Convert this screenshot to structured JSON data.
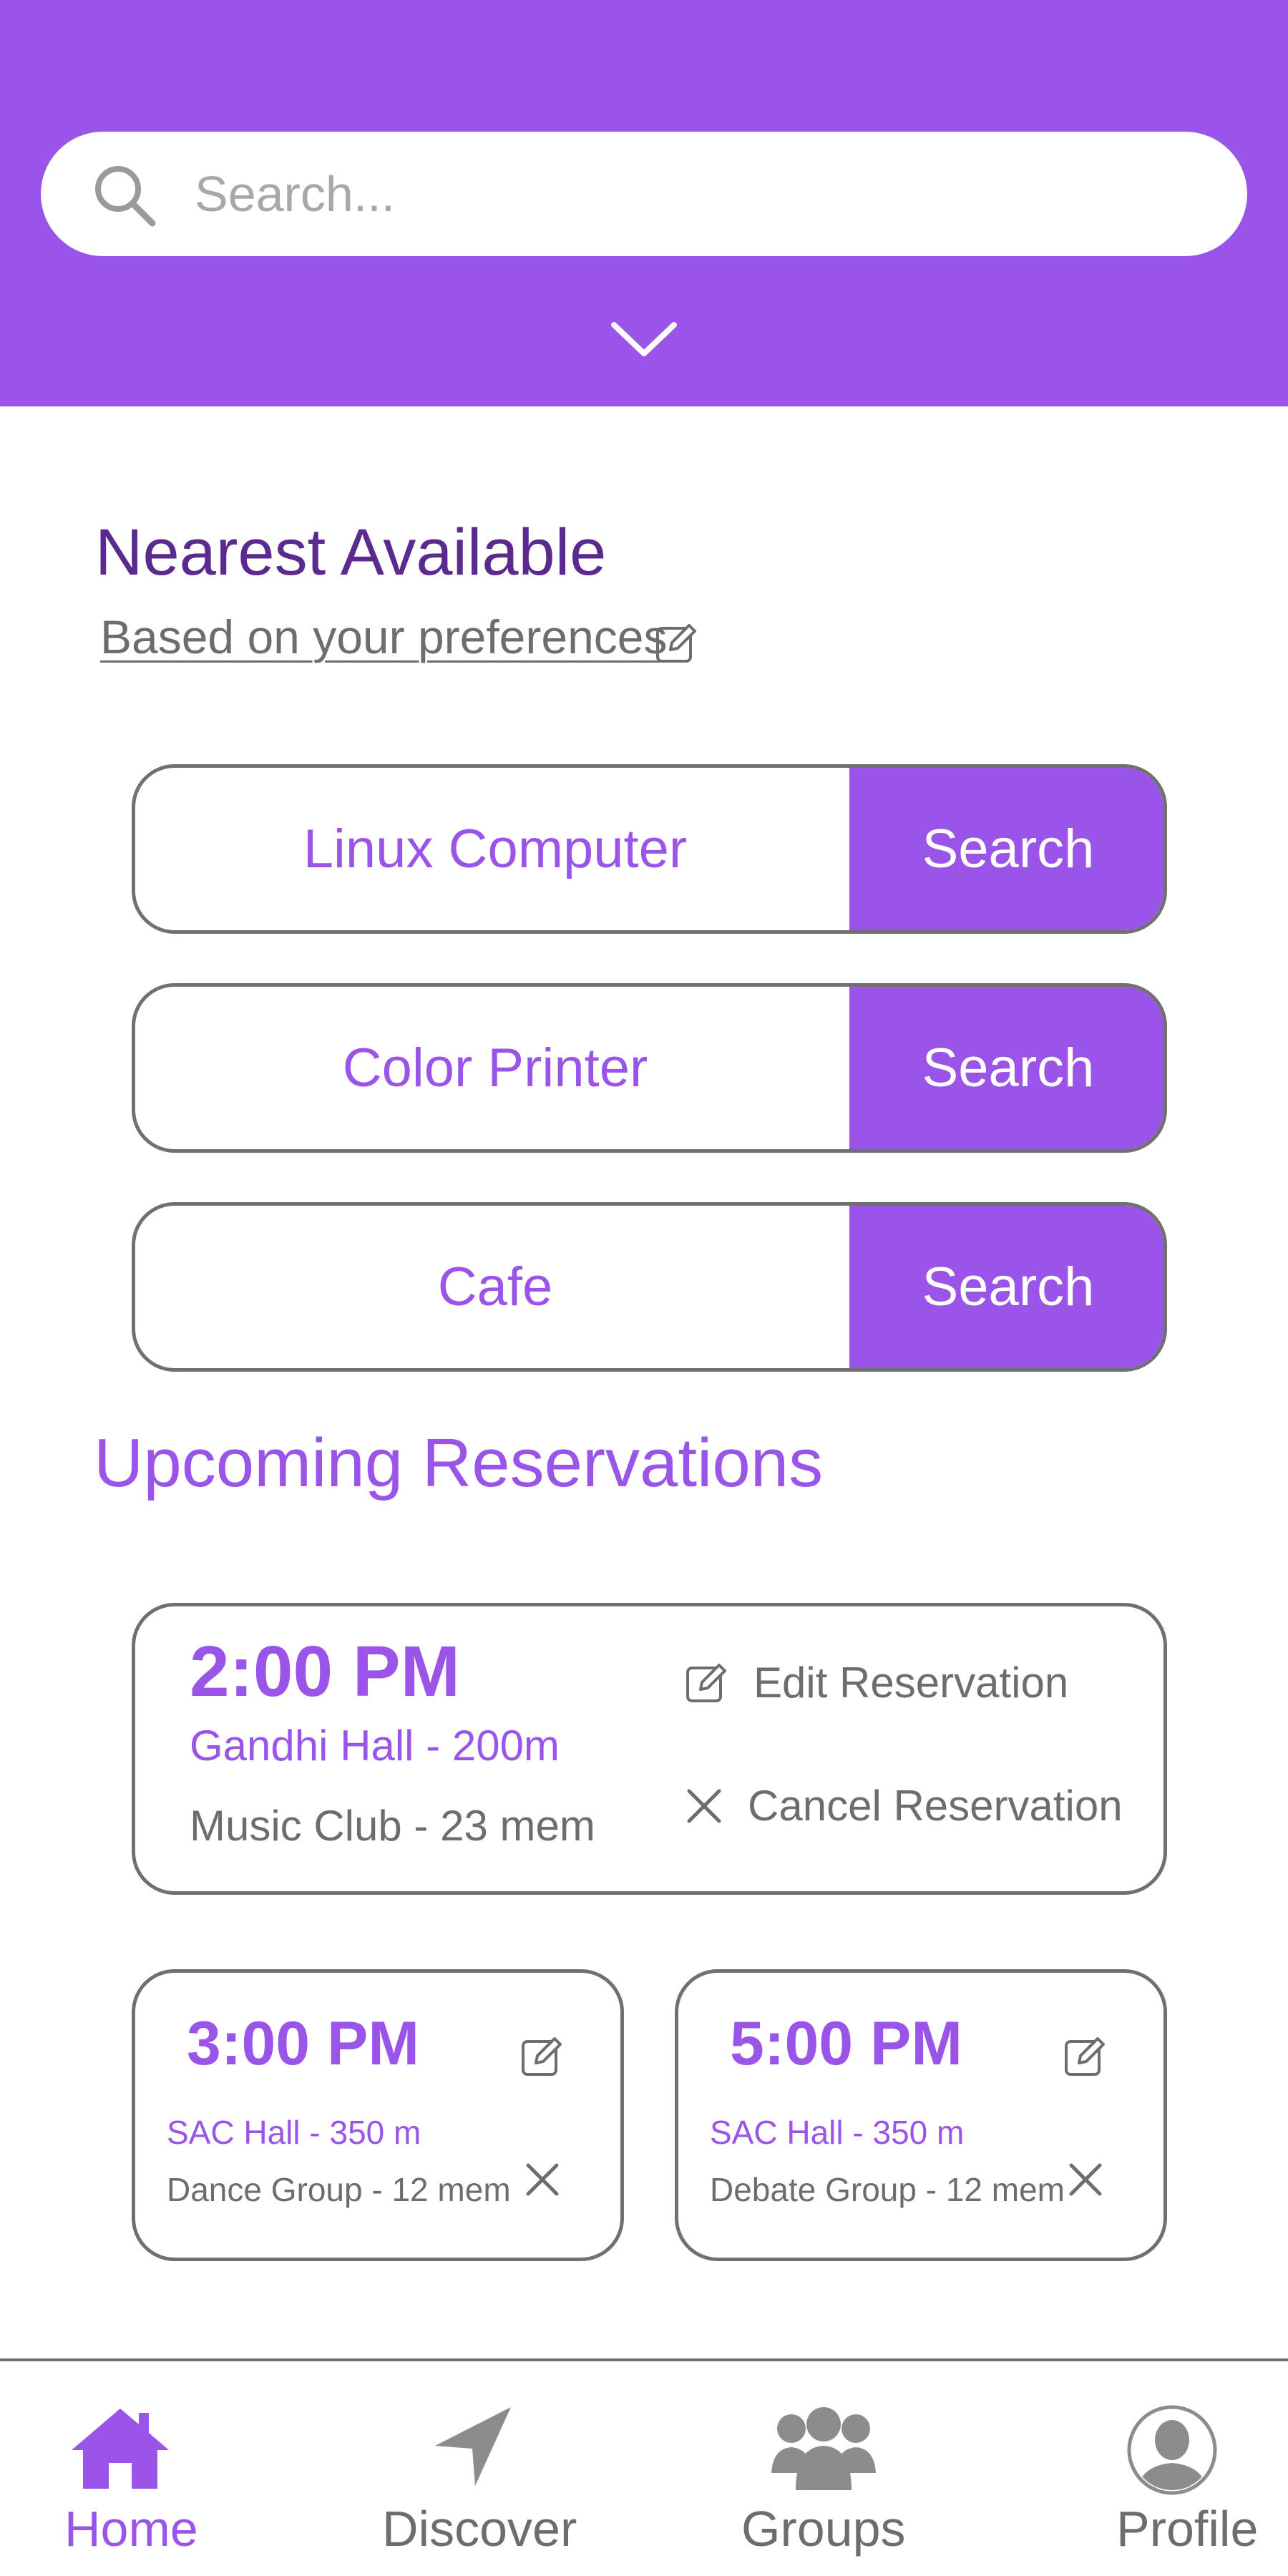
{
  "theme": {
    "accent": "#9a55e8",
    "accent_dark": "#5b2a8e",
    "border": "#707070",
    "muted_text": "#6d6d6d"
  },
  "search": {
    "placeholder": "Search...",
    "icon": "search-icon",
    "expand_icon": "chevron-down-icon"
  },
  "nearest": {
    "title": "Nearest Available",
    "subtitle": "Based on your preferences",
    "edit_icon": "pencil-icon",
    "items": [
      {
        "label": "Linux Computer",
        "button": "Search"
      },
      {
        "label": "Color Printer",
        "button": "Search"
      },
      {
        "label": "Cafe",
        "button": "Search"
      }
    ]
  },
  "upcoming": {
    "title": "Upcoming Reservations",
    "main": {
      "time": "2:00 PM",
      "location": "Gandhi Hall - 200m",
      "group": "Music Club - 23 mem",
      "edit_label": "Edit Reservation",
      "cancel_label": "Cancel Reservation"
    },
    "small": [
      {
        "time": "3:00 PM",
        "location": "SAC Hall - 350 m",
        "group": "Dance Group - 12 mem"
      },
      {
        "time": "5:00 PM",
        "location": "SAC Hall - 350 m",
        "group": "Debate Group - 12 mem"
      }
    ]
  },
  "nav": [
    {
      "label": "Home",
      "icon": "home-icon",
      "active": true
    },
    {
      "label": "Discover",
      "icon": "navigation-arrow-icon",
      "active": false
    },
    {
      "label": "Groups",
      "icon": "groups-icon",
      "active": false
    },
    {
      "label": "Profile",
      "icon": "profile-icon",
      "active": false
    }
  ]
}
